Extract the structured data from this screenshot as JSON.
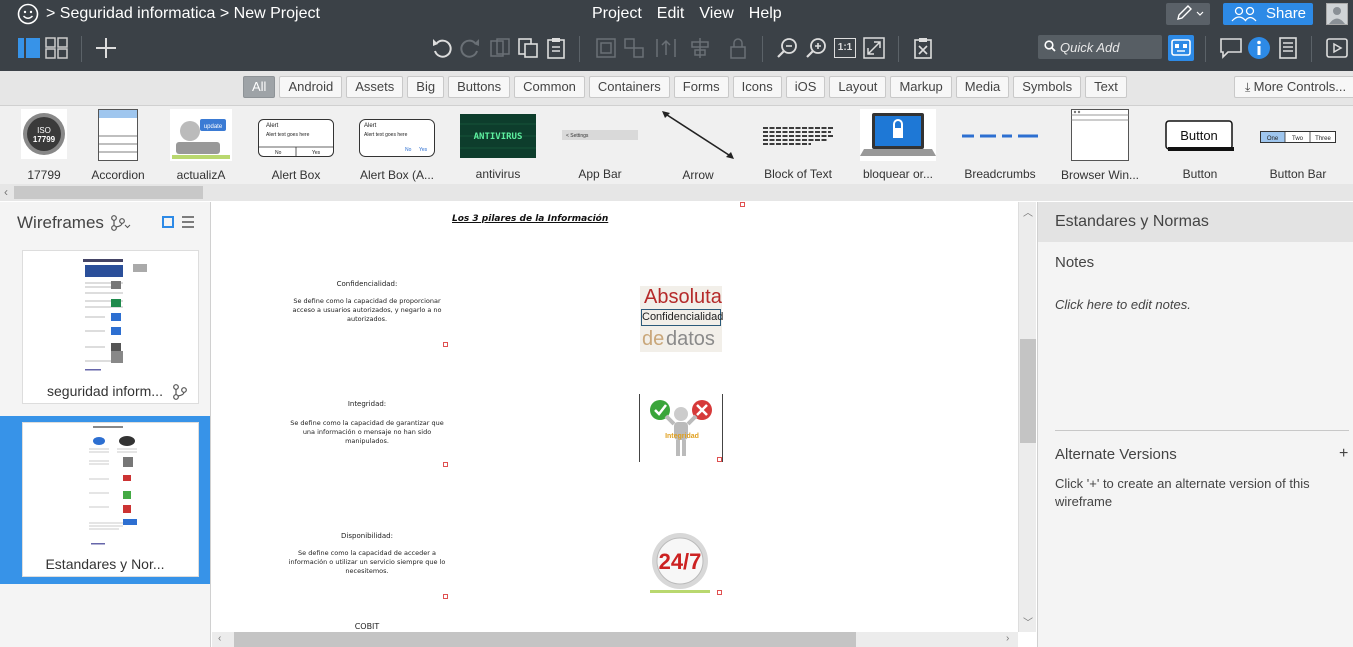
{
  "titlebar": {
    "breadcrumb": "> Seguridad informatica > New Project",
    "menu": [
      "Project",
      "Edit",
      "View",
      "Help"
    ],
    "share_label": "Share"
  },
  "toolbar": {
    "quick_add_placeholder": "Quick Add",
    "zoom_actual_label": "1:1"
  },
  "filters": {
    "items": [
      "All",
      "Android",
      "Assets",
      "Big",
      "Buttons",
      "Common",
      "Containers",
      "Forms",
      "Icons",
      "iOS",
      "Layout",
      "Markup",
      "Media",
      "Symbols",
      "Text"
    ],
    "active": "All",
    "more_label": "More Controls..."
  },
  "library": {
    "items": [
      {
        "label": "17799",
        "icon": "iso-seal"
      },
      {
        "label": "Accordion",
        "icon": "accordion"
      },
      {
        "label": "actualizA",
        "icon": "update-image"
      },
      {
        "label": "Alert Box",
        "icon": "alert-box"
      },
      {
        "label": "Alert Box (A...",
        "icon": "alert-box-alt"
      },
      {
        "label": "antivirus",
        "icon": "antivirus-image"
      },
      {
        "label": "App Bar",
        "icon": "app-bar"
      },
      {
        "label": "Arrow",
        "icon": "arrow"
      },
      {
        "label": "Block of Text",
        "icon": "block-of-text"
      },
      {
        "label": "bloquear or...",
        "icon": "laptop-lock-image"
      },
      {
        "label": "Breadcrumbs",
        "icon": "breadcrumbs"
      },
      {
        "label": "Browser Win...",
        "icon": "browser-window"
      },
      {
        "label": "Button",
        "icon": "button"
      },
      {
        "label": "Button Bar",
        "icon": "button-bar"
      }
    ],
    "thumb_texts": {
      "iso": "ISO",
      "iso_num": "17799",
      "update": "update",
      "alert_title": "Alert",
      "alert_text": "Alert text goes here",
      "alert_no": "No",
      "alert_yes": "Yes",
      "antivirus": "ANTIVIRUS",
      "appbar": "< Settings",
      "button": "Button",
      "btnbar": [
        "One",
        "Two",
        "Three"
      ]
    }
  },
  "wireframes": {
    "title": "Wireframes",
    "items": [
      {
        "name": "seguridad inform...",
        "selected": false
      },
      {
        "name": "Estandares y Nor...",
        "selected": true
      }
    ]
  },
  "canvas": {
    "title": "Los 3 pilares de la Información",
    "sections": [
      {
        "heading": "Confidencialidad:",
        "body": "Se define como la capacidad de proporcionar acceso a usuarios autorizados, y negarlo a no autorizados."
      },
      {
        "heading": "Integridad:",
        "body": "Se define como la capacidad de garantizar que una información o mensaje no han sido manipulados."
      },
      {
        "heading": "Disponibilidad:",
        "body": "Se define como la capacidad de acceder a información o utilizar un servicio siempre que lo necesitemos."
      }
    ],
    "image_texts": {
      "absoluta": "Absoluta",
      "confidencialidad": "Confidencialidad",
      "de": "de",
      "datos": "datos",
      "integridad": "Integridad",
      "twentyfour": "24/7"
    },
    "next_heading": "COBIT"
  },
  "inspector": {
    "title": "Estandares y Normas",
    "notes_heading": "Notes",
    "notes_placeholder": "Click here to edit notes.",
    "alt_heading": "Alternate Versions",
    "alt_plus": "+",
    "alt_description": "Click '+' to create an alternate version of this wireframe"
  },
  "colors": {
    "chrome_dark": "#3b4147",
    "accent_blue": "#2d8ae6",
    "selected_wireframe": "#3793e8"
  }
}
